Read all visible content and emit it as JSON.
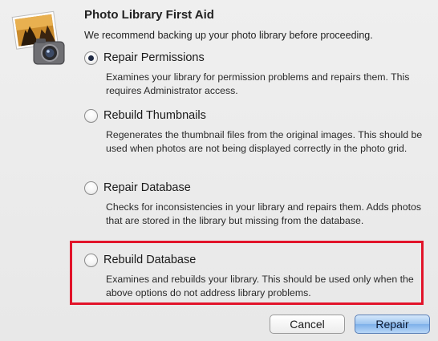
{
  "dialog": {
    "title": "Photo Library First Aid",
    "subtitle": "We recommend backing up your photo library before proceeding."
  },
  "options": [
    {
      "label": "Repair Permissions",
      "selected": true,
      "description": "Examines your library for permission problems and repairs them. This requires Administrator access."
    },
    {
      "label": "Rebuild Thumbnails",
      "selected": false,
      "description": "Regenerates the thumbnail files from the original images. This should be used when photos are not being displayed correctly in the photo grid."
    },
    {
      "label": "Repair Database",
      "selected": false,
      "description": "Checks for inconsistencies in your library and repairs them. Adds photos that are stored in the library but missing from the database."
    },
    {
      "label": "Rebuild Database",
      "selected": false,
      "description": "Examines and rebuilds your library. This should be used only when the above options do not address library problems."
    }
  ],
  "buttons": {
    "cancel": "Cancel",
    "repair": "Repair"
  },
  "icons": {
    "app": "iphoto-camera-icon"
  },
  "colors": {
    "highlight": "#e2142a",
    "default_button": "#7db0ea"
  }
}
